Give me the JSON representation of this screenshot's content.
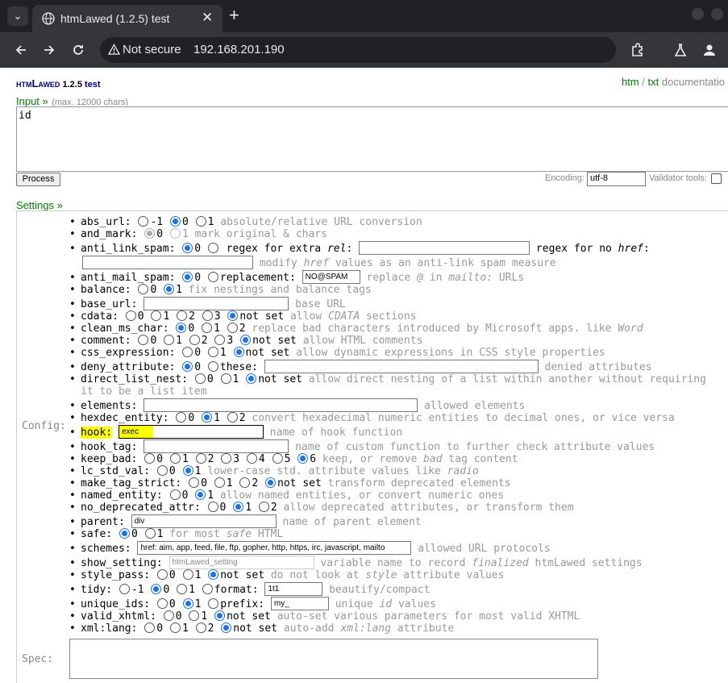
{
  "browser": {
    "tab_title": "htmLawed (1.2.5) test",
    "security_label": "Not secure",
    "url": "192.168.201.190"
  },
  "header": {
    "logo_main": "htmLawed",
    "logo_version": "1.2.5",
    "logo_suffix": "test",
    "link_htm": "htm",
    "link_sep": "/",
    "link_txt": "txt",
    "link_doc": "documentatio"
  },
  "input": {
    "label": "Input »",
    "hint": "(max. 12000 chars)",
    "value": "id",
    "process_label": "Process",
    "encoding_label": "Encoding:",
    "encoding_value": "utf-8",
    "validator_label": "Validator tools:"
  },
  "settings": {
    "label": "Settings »",
    "config_label": "Config:",
    "spec_label": "Spec:",
    "rows": {
      "abs_url": {
        "name": "abs_url:",
        "o1": "-1",
        "o2": "0",
        "o3": "1",
        "desc": "absolute/relative URL conversion"
      },
      "and_mark": {
        "name": "and_mark:",
        "o1": "0",
        "o2": "1",
        "desc": "mark original & chars"
      },
      "anti_link_spam": {
        "name": "anti_link_spam:",
        "o1": "0",
        "o2": "regex for extra",
        "o2b": "rel",
        "o3": "regex for no",
        "o3b": "href",
        "desc_a": "modify",
        "desc_b": "href",
        "desc_c": "values as an anti-link spam measure"
      },
      "anti_mail_spam": {
        "name": "anti_mail_spam:",
        "o1": "0",
        "o2": "replacement:",
        "value": "NO@SPAM",
        "desc_a": "replace",
        "desc_b": "@",
        "desc_c": "in",
        "desc_d": "mailto:",
        "desc_e": "URLs"
      },
      "balance": {
        "name": "balance:",
        "o1": "0",
        "o2": "1",
        "desc": "fix nestings and balance tags"
      },
      "base_url": {
        "name": "base_url:",
        "desc": "base URL"
      },
      "cdata": {
        "name": "cdata:",
        "o1": "0",
        "o2": "1",
        "o3": "2",
        "o4": "3",
        "o5": "not set",
        "desc_a": "allow",
        "desc_b": "CDATA",
        "desc_c": "sections"
      },
      "clean_ms_char": {
        "name": "clean_ms_char:",
        "o1": "0",
        "o2": "1",
        "o3": "2",
        "desc_a": "replace bad characters introduced by Microsoft apps. like",
        "desc_b": "Word"
      },
      "comment": {
        "name": "comment:",
        "o1": "0",
        "o2": "1",
        "o3": "2",
        "o4": "3",
        "o5": "not set",
        "desc": "allow HTML comments"
      },
      "css_expression": {
        "name": "css_expression:",
        "o1": "0",
        "o2": "1",
        "o3": "not set",
        "desc": "allow dynamic expressions in CSS style properties"
      },
      "deny_attribute": {
        "name": "deny_attribute:",
        "o1": "0",
        "o2": "these:",
        "desc": "denied attributes"
      },
      "direct_list_nest": {
        "name": "direct_list_nest:",
        "o1": "0",
        "o2": "1",
        "o3": "not set",
        "desc": "allow direct nesting of a list within another without requiring",
        "desc2": "it to be a list item"
      },
      "elements": {
        "name": "elements:",
        "desc": "allowed elements"
      },
      "hexdec_entity": {
        "name": "hexdec_entity:",
        "o1": "0",
        "o2": "1",
        "o3": "2",
        "desc": "convert hexadecimal numeric entities to decimal ones, or vice versa"
      },
      "hook": {
        "name": "hook:",
        "value": "exec",
        "desc": "name of hook function"
      },
      "hook_tag": {
        "name": "hook_tag:",
        "desc": "name of custom function to further check attribute values"
      },
      "keep_bad": {
        "name": "keep_bad:",
        "o1": "0",
        "o2": "1",
        "o3": "2",
        "o4": "3",
        "o5": "4",
        "o6": "5",
        "o7": "6",
        "desc_a": "keep, or remove",
        "desc_b": "bad",
        "desc_c": "tag content"
      },
      "lc_std_val": {
        "name": "lc_std_val:",
        "o1": "0",
        "o2": "1",
        "desc_a": "lower-case std. attribute values like",
        "desc_b": "radio"
      },
      "make_tag_strict": {
        "name": "make_tag_strict:",
        "o1": "0",
        "o2": "1",
        "o3": "2",
        "o4": "not set",
        "desc": "transform deprecated elements"
      },
      "named_entity": {
        "name": "named_entity:",
        "o1": "0",
        "o2": "1",
        "desc": "allow named entities, or convert numeric ones"
      },
      "no_deprecated_attr": {
        "name": "no_deprecated_attr:",
        "o1": "0",
        "o2": "1",
        "o3": "2",
        "desc": "allow deprecated attributes, or transform them"
      },
      "parent": {
        "name": "parent:",
        "value": "div",
        "desc": "name of parent element"
      },
      "safe": {
        "name": "safe:",
        "o1": "0",
        "o2": "1",
        "desc_a": "for most",
        "desc_b": "safe",
        "desc_c": "HTML"
      },
      "schemes": {
        "name": "schemes:",
        "value": "href: aim, app, feed, file, ftp, gopher, http, https, irc, javascript, mailto",
        "desc": "allowed URL protocols"
      },
      "show_setting": {
        "name": "show_setting:",
        "value": "htmLawed_setting",
        "desc_a": "variable name to record",
        "desc_b": "finalized",
        "desc_c": "htmLawed settings"
      },
      "style_pass": {
        "name": "style_pass:",
        "o1": "0",
        "o2": "1",
        "o3": "not set",
        "desc_a": "do not look at",
        "desc_b": "style",
        "desc_c": "attribute values"
      },
      "tidy": {
        "name": "tidy:",
        "o1": "-1",
        "o2": "0",
        "o3": "1",
        "o4": "format:",
        "value": "1t1",
        "desc": "beautify/compact"
      },
      "unique_ids": {
        "name": "unique_ids:",
        "o1": "0",
        "o2": "1",
        "o3": "prefix:",
        "value": "my_",
        "desc_a": "unique",
        "desc_b": "id",
        "desc_c": "values"
      },
      "valid_xhtml": {
        "name": "valid_xhtml:",
        "o1": "0",
        "o2": "1",
        "o3": "not set",
        "desc": "auto-set various parameters for most valid XHTML"
      },
      "xml_lang": {
        "name": "xml:lang:",
        "o1": "0",
        "o2": "1",
        "o3": "2",
        "o4": "not set",
        "desc_a": "auto-add",
        "desc_b": "xml:lang",
        "desc_c": "attribute"
      }
    }
  }
}
